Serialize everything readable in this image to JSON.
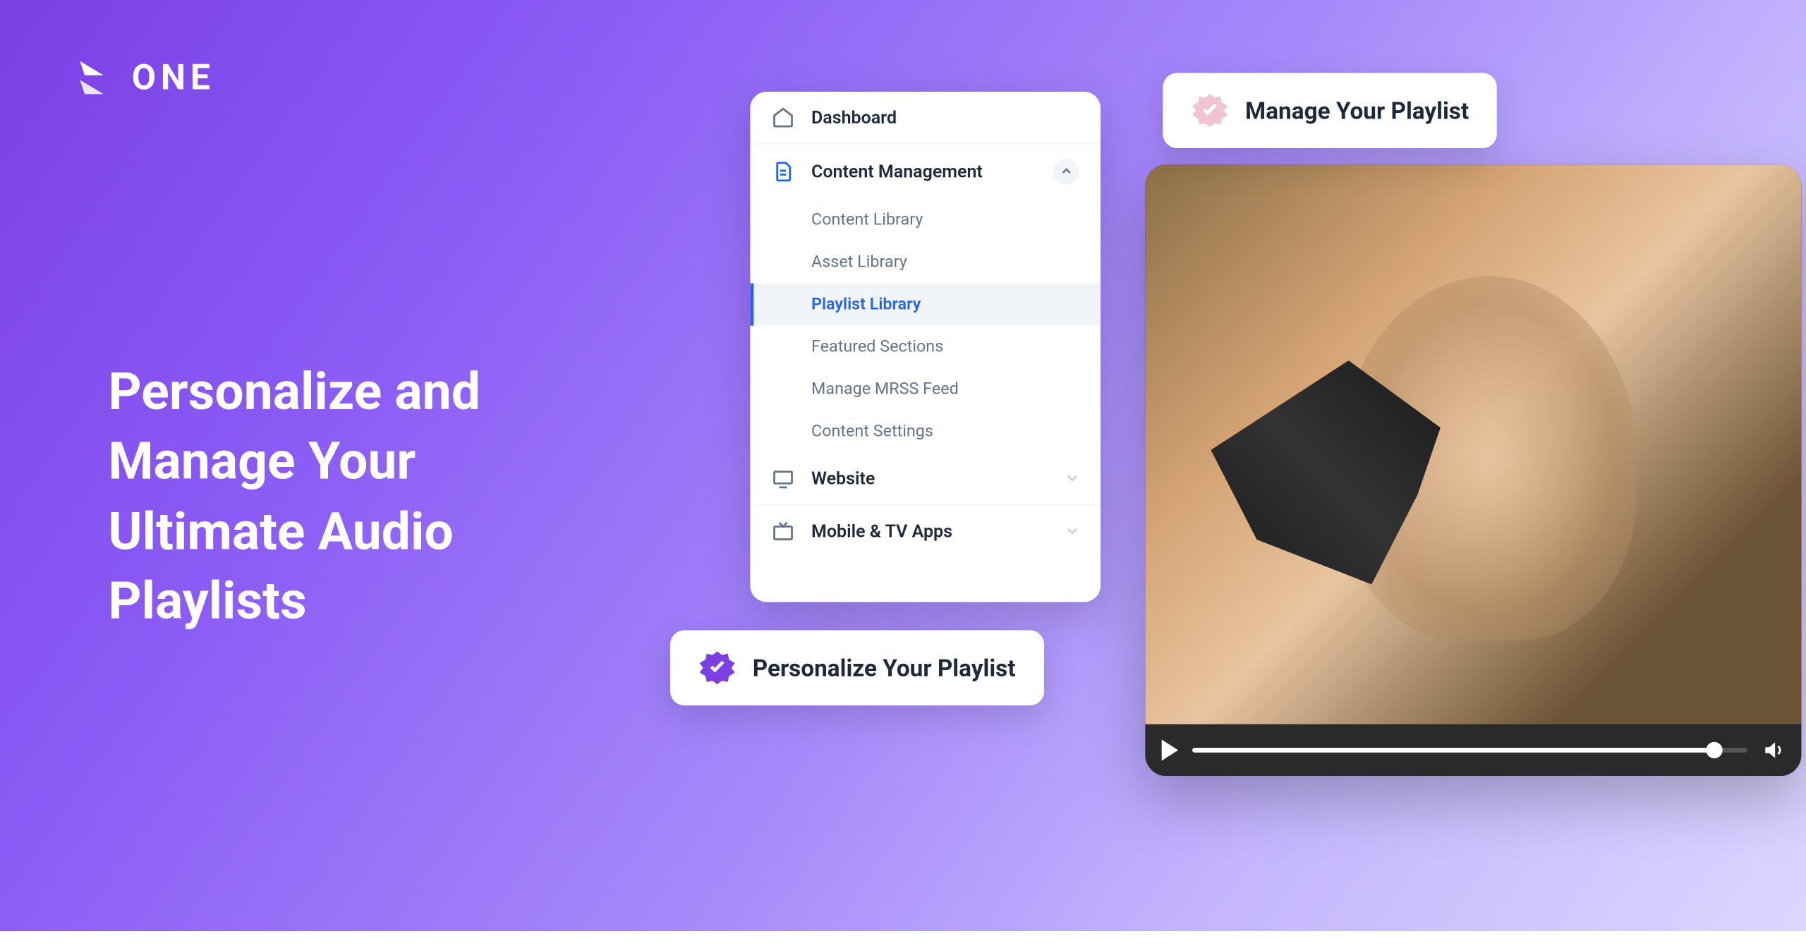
{
  "logo": {
    "text": "ONE"
  },
  "headline": "Personalize and Manage Your Ultimate Audio Playlists",
  "sidebar": {
    "items": [
      {
        "label": "Dashboard",
        "icon": "home"
      },
      {
        "label": "Content Management",
        "icon": "document",
        "expanded": true
      },
      {
        "label": "Website",
        "icon": "monitor"
      },
      {
        "label": "Mobile & TV Apps",
        "icon": "tv"
      }
    ],
    "subitems": [
      {
        "label": "Content Library"
      },
      {
        "label": "Asset Library"
      },
      {
        "label": "Playlist Library",
        "active": true
      },
      {
        "label": "Featured Sections"
      },
      {
        "label": "Manage MRSS Feed"
      },
      {
        "label": "Content Settings"
      }
    ]
  },
  "badges": {
    "manage": "Manage Your Playlist",
    "personalize": "Personalize Your Playlist"
  },
  "colors": {
    "accent_blue": "#2563EB",
    "accent_purple": "#7B3FE4",
    "badge_pink": "#F0C4D4"
  }
}
